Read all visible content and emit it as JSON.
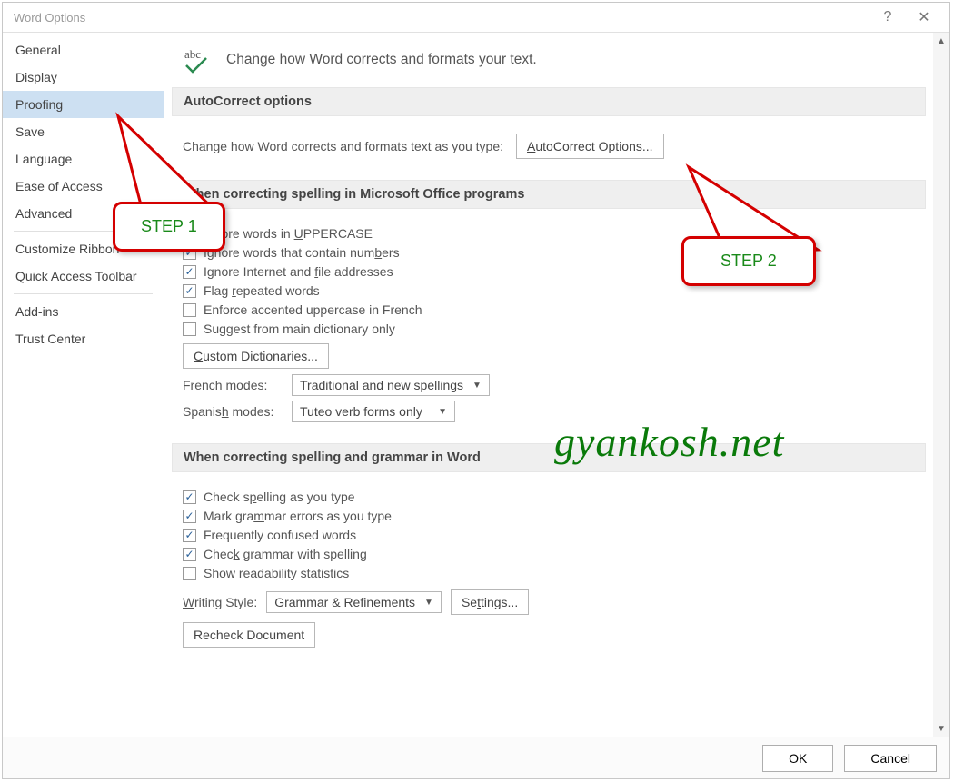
{
  "title": "Word Options",
  "sidebar": {
    "items": [
      {
        "label": "General"
      },
      {
        "label": "Display"
      },
      {
        "label": "Proofing",
        "selected": true
      },
      {
        "label": "Save"
      },
      {
        "label": "Language"
      },
      {
        "label": "Ease of Access"
      },
      {
        "label": "Advanced"
      }
    ],
    "group2": [
      {
        "label": "Customize Ribbon"
      },
      {
        "label": "Quick Access Toolbar"
      }
    ],
    "group3": [
      {
        "label": "Add-ins"
      },
      {
        "label": "Trust Center"
      }
    ]
  },
  "header": {
    "text": "Change how Word corrects and formats your text."
  },
  "sections": {
    "autocorrect": {
      "title": "AutoCorrect options",
      "desc": "Change how Word corrects and formats text as you type:",
      "button": "AutoCorrect Options..."
    },
    "spelling_office": {
      "title": "When correcting spelling in Microsoft Office programs",
      "opts": [
        {
          "label": "Ignore words in UPPERCASE",
          "checked": true
        },
        {
          "label": "Ignore words that contain numbers",
          "checked": true
        },
        {
          "label": "Ignore Internet and file addresses",
          "checked": true
        },
        {
          "label": "Flag repeated words",
          "checked": true
        },
        {
          "label": "Enforce accented uppercase in French",
          "checked": false
        },
        {
          "label": "Suggest from main dictionary only",
          "checked": false
        }
      ],
      "custom_dict_btn": "Custom Dictionaries...",
      "french_label": "French modes:",
      "french_value": "Traditional and new spellings",
      "spanish_label": "Spanish modes:",
      "spanish_value": "Tuteo verb forms only"
    },
    "spelling_word": {
      "title": "When correcting spelling and grammar in Word",
      "opts": [
        {
          "label": "Check spelling as you type",
          "checked": true
        },
        {
          "label": "Mark grammar errors as you type",
          "checked": true
        },
        {
          "label": "Frequently confused words",
          "checked": true
        },
        {
          "label": "Check grammar with spelling",
          "checked": true
        },
        {
          "label": "Show readability statistics",
          "checked": false
        }
      ],
      "writing_style_label": "Writing Style:",
      "writing_style_value": "Grammar & Refinements",
      "settings_btn": "Settings...",
      "recheck_btn": "Recheck Document"
    }
  },
  "footer": {
    "ok": "OK",
    "cancel": "Cancel"
  },
  "callouts": {
    "step1": "STEP 1",
    "step2": "STEP 2"
  },
  "watermark": "gyankosh.net"
}
